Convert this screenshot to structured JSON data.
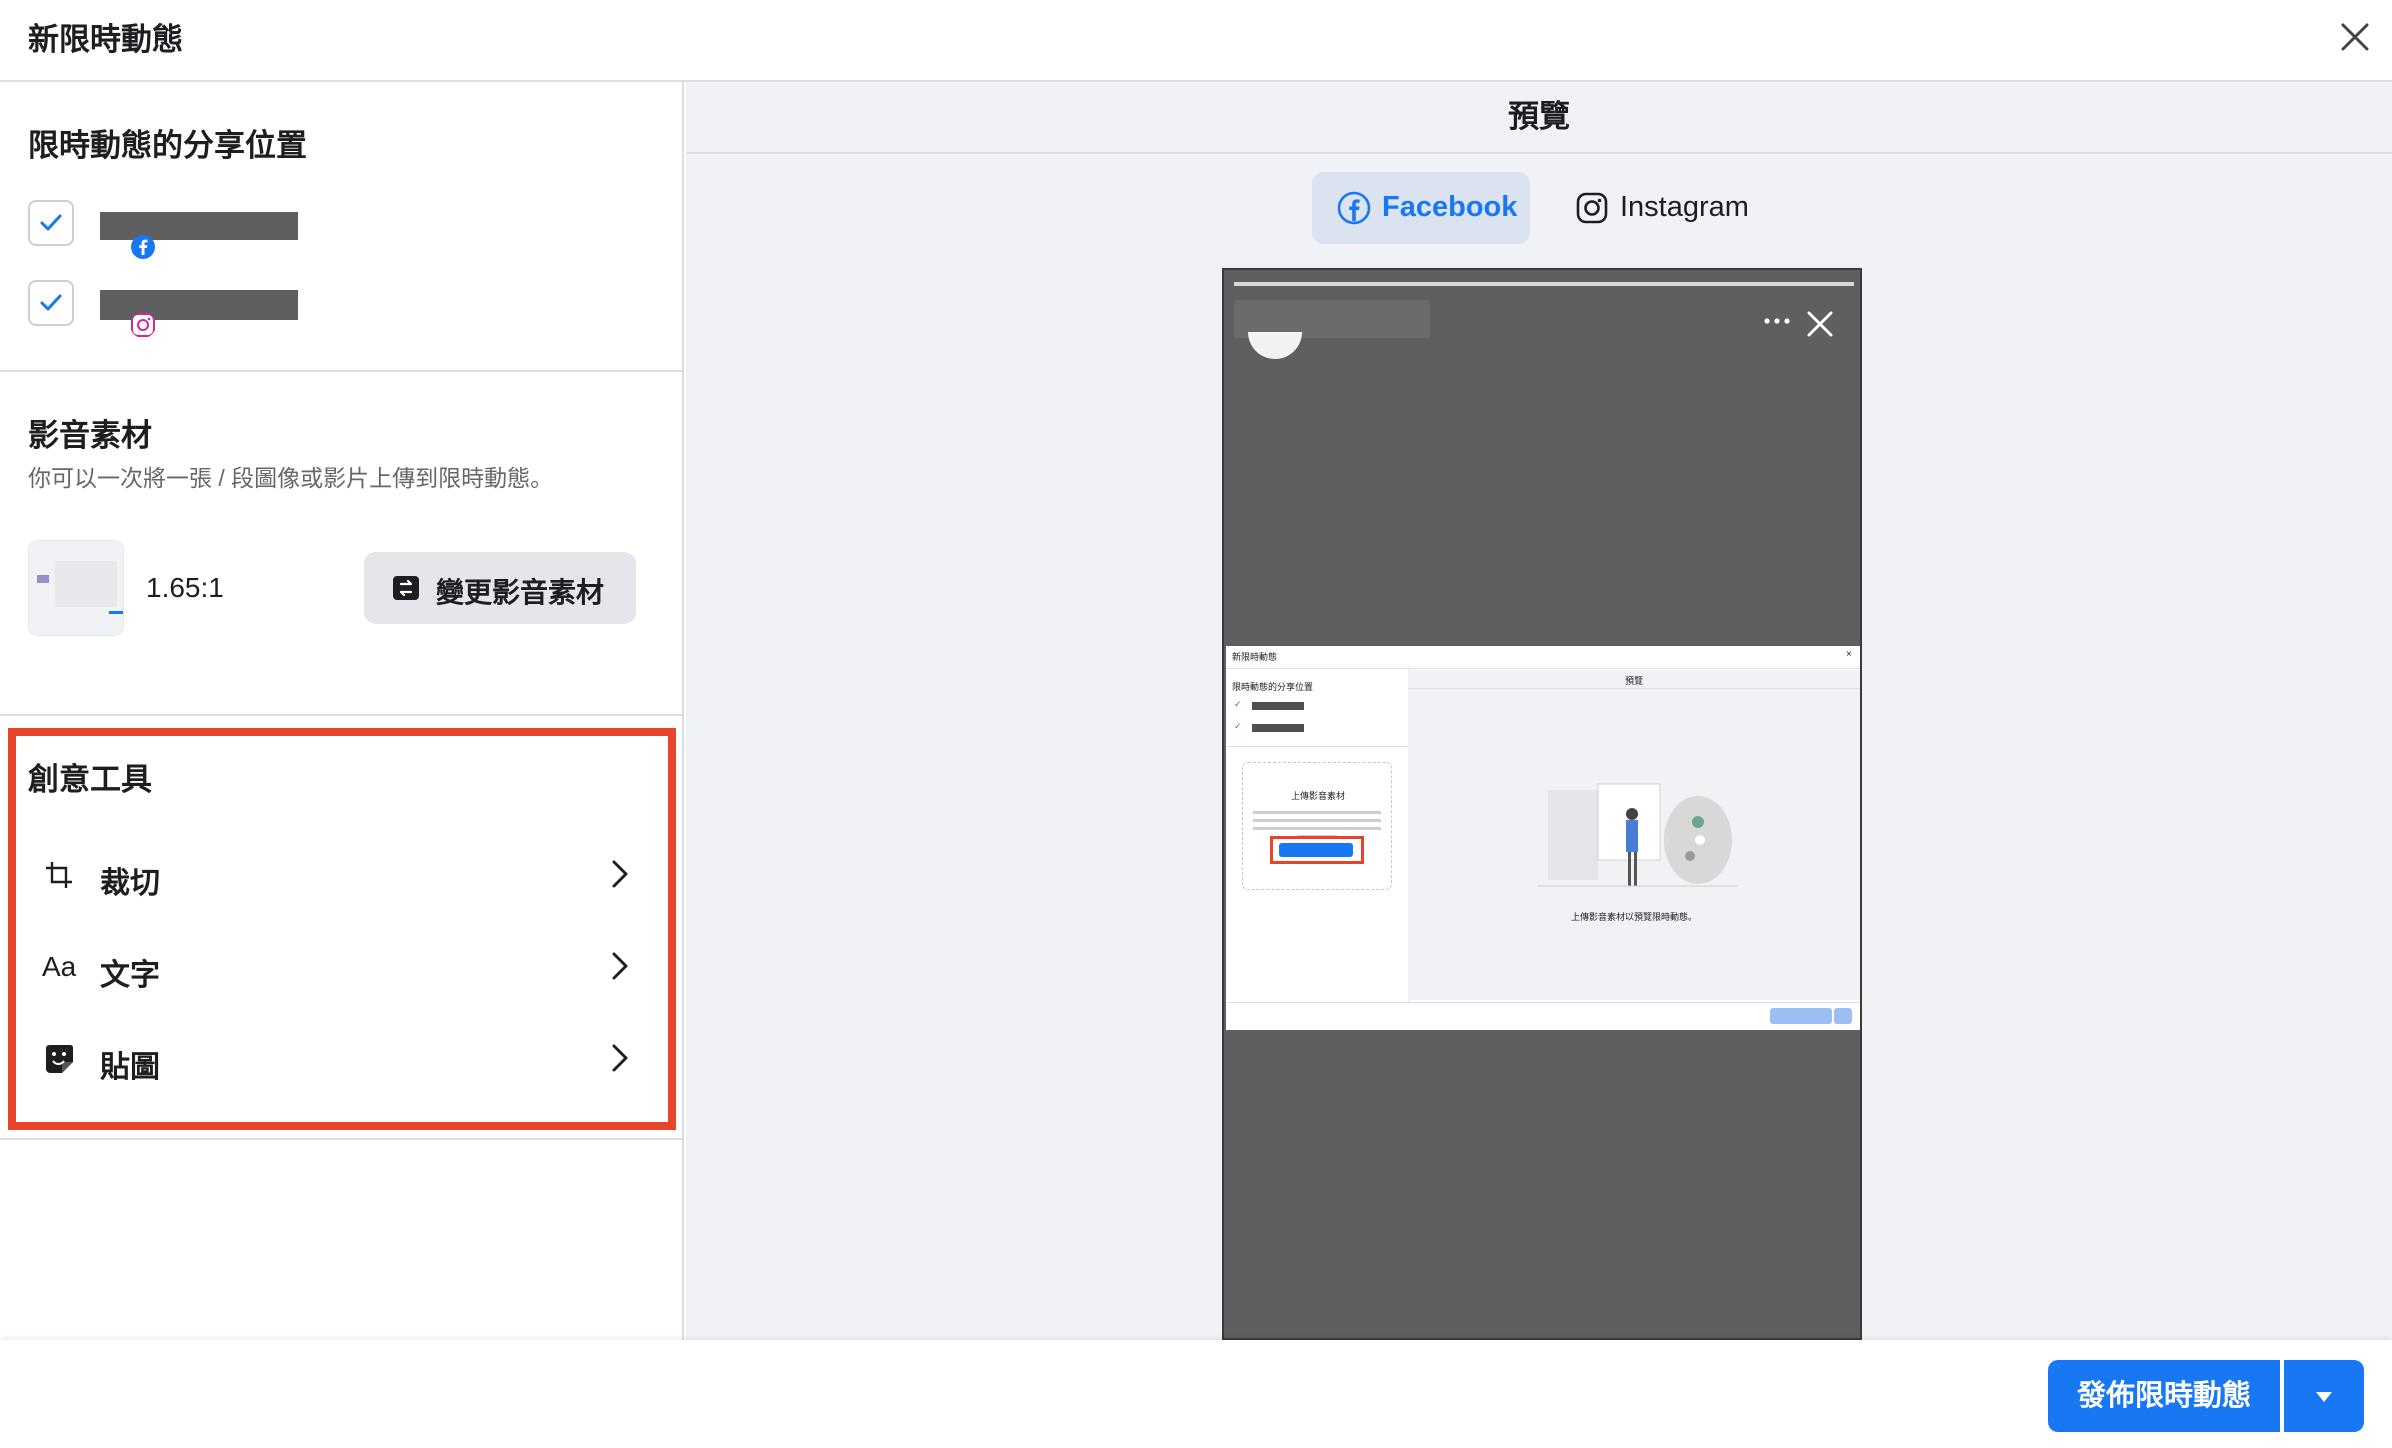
{
  "window": {
    "title": "新限時動態"
  },
  "left": {
    "share_section": {
      "title": "限時動態的分享位置"
    },
    "media_section": {
      "title": "影音素材",
      "description": "你可以一次將一張 / 段圖像或影片上傳到限時動態。",
      "aspect_ratio": "1.65:1",
      "change_button": "變更影音素材"
    },
    "creative_section": {
      "title": "創意工具",
      "tools": [
        {
          "label": "裁切",
          "icon": "crop-icon"
        },
        {
          "label": "文字",
          "icon_text": "Aa"
        },
        {
          "label": "貼圖",
          "icon": "sticker-icon"
        }
      ]
    }
  },
  "preview": {
    "title": "預覽",
    "tabs": [
      {
        "label": "Facebook",
        "icon": "facebook-icon",
        "active": true
      },
      {
        "label": "Instagram",
        "icon": "instagram-icon",
        "active": false
      }
    ],
    "mini": {
      "title": "新限時動態",
      "share_title": "限時動態的分享位置",
      "preview_title": "預覽",
      "upload_title": "上傳影音素材",
      "upload_caption": "上傳影音素材以預覽限時動態。"
    }
  },
  "footer": {
    "publish_label": "發佈限時動態"
  },
  "colors": {
    "accent": "#1877f2",
    "highlight": "#e8432b"
  }
}
